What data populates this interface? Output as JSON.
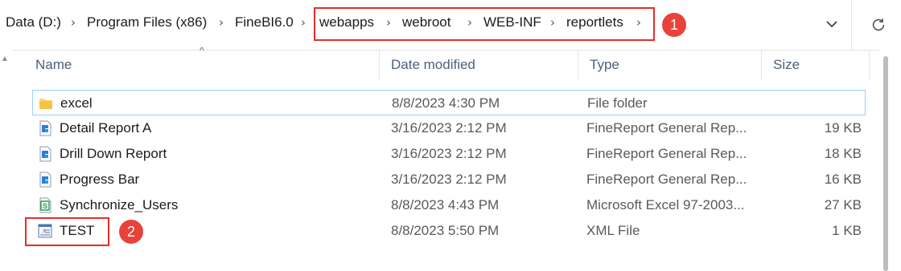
{
  "address": {
    "crumbs": [
      "Data (D:)",
      "Program Files (x86)",
      "FineBI6.0",
      "webapps",
      "webroot",
      "WEB-INF",
      "reportlets"
    ],
    "separator": "›"
  },
  "annotations": {
    "one": "1",
    "two": "2",
    "color": "#e0302b"
  },
  "columns": {
    "name": "Name",
    "date": "Date modified",
    "type": "Type",
    "size": "Size"
  },
  "files": [
    {
      "name": "excel",
      "date": "8/8/2023 4:30 PM",
      "type": "File folder",
      "size": "",
      "icon": "folder-icon",
      "selected": true
    },
    {
      "name": "Detail Report A",
      "date": "3/16/2023 2:12 PM",
      "type": "FineReport General Rep...",
      "size": "19 KB",
      "icon": "finereport-file-icon"
    },
    {
      "name": "Drill Down Report",
      "date": "3/16/2023 2:12 PM",
      "type": "FineReport General Rep...",
      "size": "18 KB",
      "icon": "finereport-file-icon"
    },
    {
      "name": "Progress Bar",
      "date": "3/16/2023 2:12 PM",
      "type": "FineReport General Rep...",
      "size": "16 KB",
      "icon": "finereport-file-icon"
    },
    {
      "name": "Synchronize_Users",
      "date": "8/8/2023 4:43 PM",
      "type": "Microsoft Excel 97-2003...",
      "size": "27 KB",
      "icon": "excel-file-icon"
    },
    {
      "name": "TEST",
      "date": "8/8/2023 5:50 PM",
      "type": "XML File",
      "size": "1 KB",
      "icon": "xml-file-icon"
    }
  ]
}
